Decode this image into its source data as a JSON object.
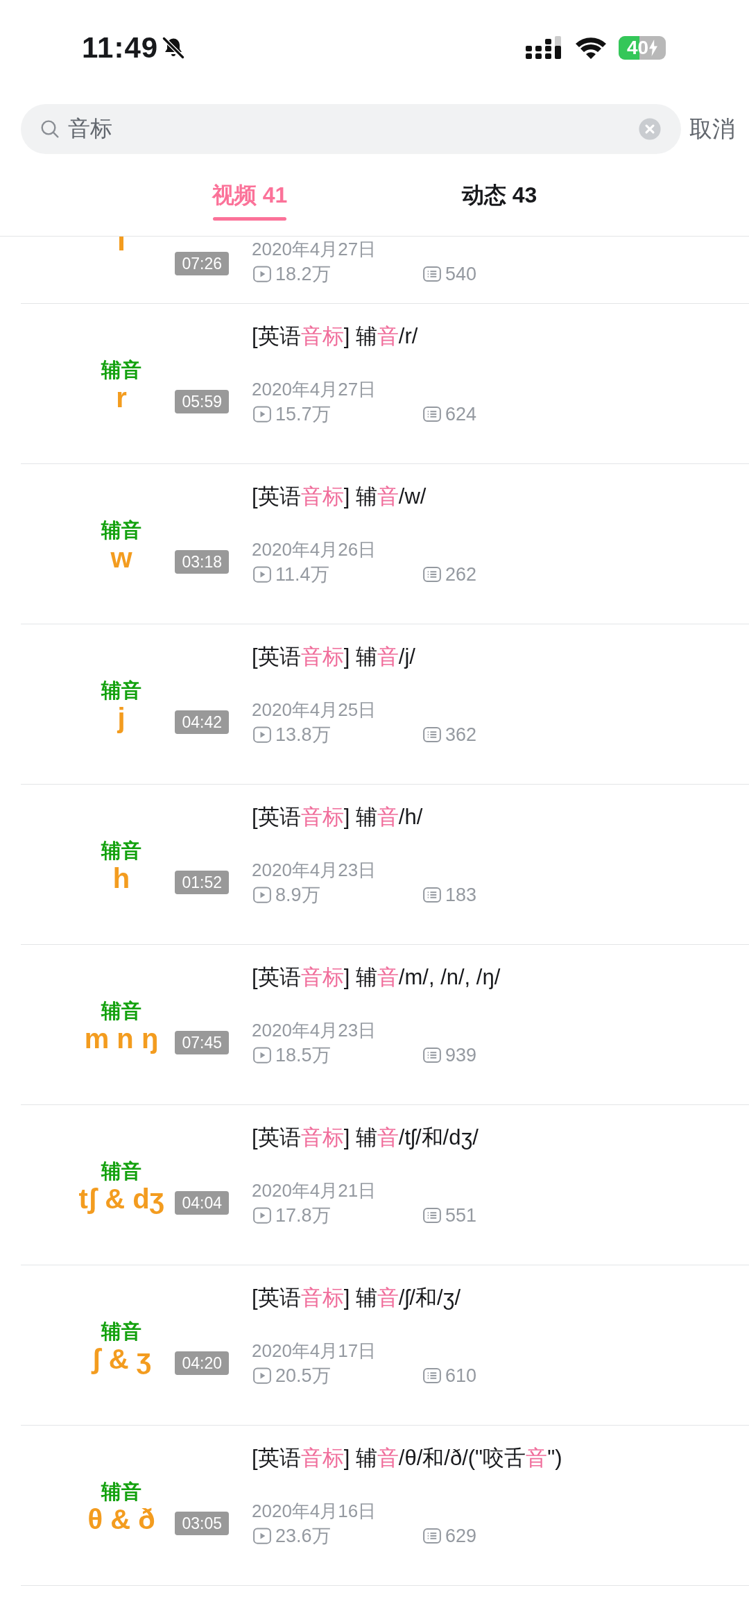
{
  "status_bar": {
    "time": "11:49",
    "battery": "40"
  },
  "search": {
    "value": "音标",
    "cancel": "取消"
  },
  "tabs": [
    {
      "label": "视频 41",
      "selected": true
    },
    {
      "label": "动态 43",
      "selected": false
    }
  ],
  "videos": [
    {
      "kind": "partial",
      "date": "2020年4月27日",
      "views": "18.2万",
      "comments": "540",
      "duration": "07:26"
    },
    {
      "kind": "full",
      "cover_label": "辅音",
      "cover_symbol": "r",
      "title": [
        {
          "text": "[英语",
          "pink": false
        },
        {
          "text": "音标",
          "pink": true
        },
        {
          "text": "] 辅",
          "pink": false
        },
        {
          "text": "音",
          "pink": true
        },
        {
          "text": "/r/",
          "pink": false
        }
      ],
      "date": "2020年4月27日",
      "views": "15.7万",
      "comments": "624",
      "duration": "05:59"
    },
    {
      "kind": "full",
      "cover_label": "辅音",
      "cover_symbol": "w",
      "title": [
        {
          "text": "[英语",
          "pink": false
        },
        {
          "text": "音标",
          "pink": true
        },
        {
          "text": "] 辅",
          "pink": false
        },
        {
          "text": "音",
          "pink": true
        },
        {
          "text": "/w/",
          "pink": false
        }
      ],
      "date": "2020年4月26日",
      "views": "11.4万",
      "comments": "262",
      "duration": "03:18"
    },
    {
      "kind": "full",
      "cover_label": "辅音",
      "cover_symbol": "j",
      "title": [
        {
          "text": "[英语",
          "pink": false
        },
        {
          "text": "音标",
          "pink": true
        },
        {
          "text": "] 辅",
          "pink": false
        },
        {
          "text": "音",
          "pink": true
        },
        {
          "text": "/j/",
          "pink": false
        }
      ],
      "date": "2020年4月25日",
      "views": "13.8万",
      "comments": "362",
      "duration": "04:42"
    },
    {
      "kind": "full",
      "cover_label": "辅音",
      "cover_symbol": "h",
      "title": [
        {
          "text": "[英语",
          "pink": false
        },
        {
          "text": "音标",
          "pink": true
        },
        {
          "text": "] 辅",
          "pink": false
        },
        {
          "text": "音",
          "pink": true
        },
        {
          "text": "/h/",
          "pink": false
        }
      ],
      "date": "2020年4月23日",
      "views": "8.9万",
      "comments": "183",
      "duration": "01:52"
    },
    {
      "kind": "full",
      "cover_label": "辅音",
      "cover_symbol": "m n ŋ",
      "title": [
        {
          "text": "[英语",
          "pink": false
        },
        {
          "text": "音标",
          "pink": true
        },
        {
          "text": "] 辅",
          "pink": false
        },
        {
          "text": "音",
          "pink": true
        },
        {
          "text": "/m/, /n/, /ŋ/",
          "pink": false
        }
      ],
      "date": "2020年4月23日",
      "views": "18.5万",
      "comments": "939",
      "duration": "07:45"
    },
    {
      "kind": "full",
      "cover_label": "辅音",
      "cover_symbol": "tʃ & dʒ",
      "title": [
        {
          "text": "[英语",
          "pink": false
        },
        {
          "text": "音标",
          "pink": true
        },
        {
          "text": "] 辅",
          "pink": false
        },
        {
          "text": "音",
          "pink": true
        },
        {
          "text": "/tʃ/和/dʒ/",
          "pink": false
        }
      ],
      "date": "2020年4月21日",
      "views": "17.8万",
      "comments": "551",
      "duration": "04:04"
    },
    {
      "kind": "full",
      "cover_label": "辅音",
      "cover_symbol": "ʃ & ʒ",
      "title": [
        {
          "text": "[英语",
          "pink": false
        },
        {
          "text": "音标",
          "pink": true
        },
        {
          "text": "] 辅",
          "pink": false
        },
        {
          "text": "音",
          "pink": true
        },
        {
          "text": "/ʃ/和/ʒ/",
          "pink": false
        }
      ],
      "date": "2020年4月17日",
      "views": "20.5万",
      "comments": "610",
      "duration": "04:20"
    },
    {
      "kind": "full",
      "cover_label": "辅音",
      "cover_symbol": "θ & ð",
      "title": [
        {
          "text": "[英语",
          "pink": false
        },
        {
          "text": "音标",
          "pink": true
        },
        {
          "text": "] 辅",
          "pink": false
        },
        {
          "text": "音",
          "pink": true
        },
        {
          "text": "/θ/和/ð/(\"咬舌",
          "pink": false
        },
        {
          "text": "音",
          "pink": true
        },
        {
          "text": "\")",
          "pink": false
        }
      ],
      "date": "2020年4月16日",
      "views": "23.6万",
      "comments": "629",
      "duration": "03:05"
    }
  ]
}
